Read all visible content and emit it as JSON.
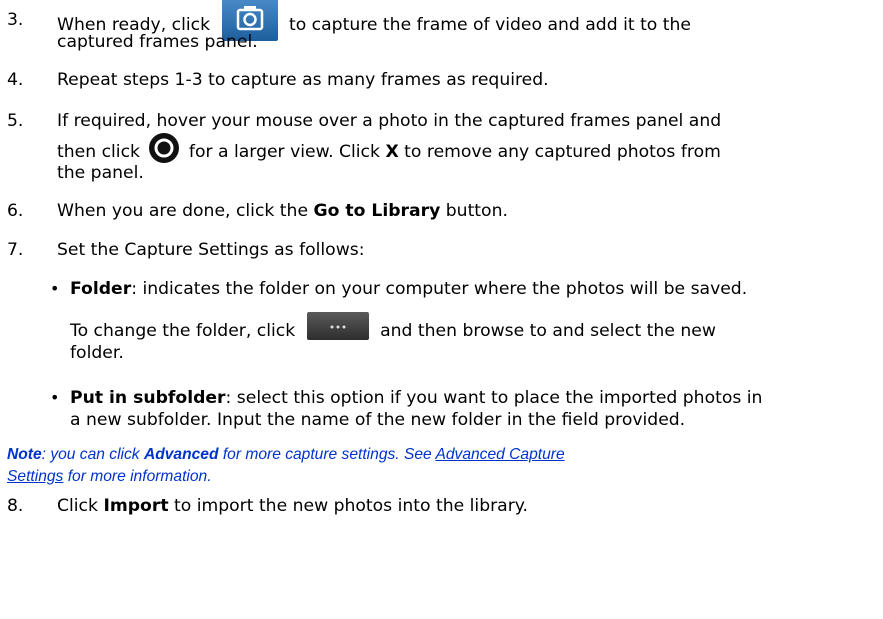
{
  "steps": [
    {
      "num": "3.",
      "l1a": "When ready, click",
      "l1b": "to capture the frame of video and add it to the",
      "l2": "captured frames panel.",
      "icon": "camera-icon"
    },
    {
      "num": "4.",
      "text": "Repeat steps 1-3 to capture as many frames as required."
    },
    {
      "num": "5.",
      "l1": "If required, hover your mouse over a photo in the captured frames panel and",
      "l2a": "then click",
      "l2b": "for a larger view. Click",
      "l2bold": "X",
      "l2c": "to remove any captured photos from",
      "l3": "the panel.",
      "icon": "view-circle-icon"
    },
    {
      "num": "6.",
      "a": "When you are done, click the",
      "bold": "Go to Library",
      "b": "button."
    },
    {
      "num": "7.",
      "text": "Set the Capture Settings as follows:"
    },
    {
      "num": "8.",
      "a": "Click",
      "bold": "Import",
      "b": "to import the new photos into the library."
    }
  ],
  "bullets": [
    {
      "bold": "Folder",
      "text": ": indicates the folder on your computer where the photos will be saved.",
      "sub_a": "To change the folder, click",
      "sub_b": "and then browse to and select the new",
      "sub_c": "folder.",
      "icon": "more-options-icon"
    },
    {
      "bold": "Put in subfolder",
      "text": ": select this option if you want to place the imported photos in",
      "l2": "a new subfolder. Input the name of the new folder in the field provided."
    }
  ],
  "note": {
    "label": "Note",
    "a": ": you can click",
    "bold": "Advanced",
    "b": "for more capture settings. See",
    "link1": "Advanced Capture",
    "link2": "Settings",
    "c": "for more information."
  }
}
